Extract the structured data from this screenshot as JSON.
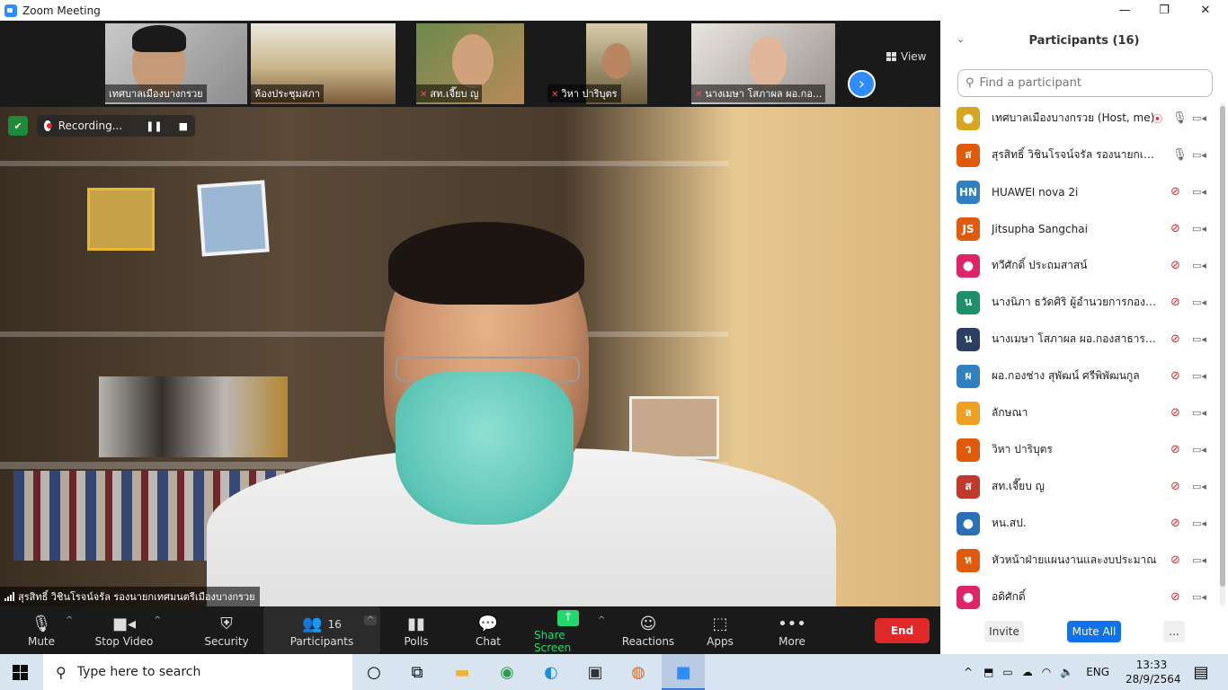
{
  "window": {
    "title": "Zoom Meeting",
    "controls": {
      "minimize": "—",
      "restore": "❐",
      "close": "✕"
    }
  },
  "thumbnails": [
    {
      "label": "เทศบาลเมืองบางกรวย",
      "muted": false
    },
    {
      "label": "ห้องประชุมสภา",
      "muted": false
    },
    {
      "label": "สท.เจี๊ยบ ญ",
      "muted": true
    },
    {
      "label": "วิหา ปาริบุตร",
      "muted": true
    },
    {
      "label": "นางเมษา โสภาผล ผอ.กอ...",
      "muted": true
    }
  ],
  "strip": {
    "next_glyph": "›",
    "view_label": "View"
  },
  "recording": {
    "label": "Recording...",
    "pause": "❚❚",
    "stop": "■",
    "shield": "✔"
  },
  "active_speaker": {
    "name": "สุรสิทธิ์ วิชินโรจน์จรัล รองนายกเทศมนตรีเมืองบางกรวย"
  },
  "toolbar": {
    "mute": "Mute",
    "stop_video": "Stop Video",
    "security": "Security",
    "participants": "Participants",
    "participants_count": "16",
    "polls": "Polls",
    "chat": "Chat",
    "share_screen": "Share Screen",
    "reactions": "Reactions",
    "apps": "Apps",
    "more": "More",
    "end": "End"
  },
  "panel": {
    "title": "Participants (16)",
    "search_placeholder": "Find a participant",
    "participants": [
      {
        "initials": "",
        "name": "เทศบาลเมืองบางกรวย (Host, me)",
        "color": "#d8a520",
        "mic": "on",
        "rec": true
      },
      {
        "initials": "ส",
        "name": "สุรสิทธิ์ วิชินโรจน์จรัล รองนายกเทศม...",
        "color": "#e05a0c",
        "mic": "on",
        "rec": false
      },
      {
        "initials": "HN",
        "name": "HUAWEI nova 2i",
        "color": "#2f7fc1",
        "mic": "off",
        "rec": false
      },
      {
        "initials": "JS",
        "name": "Jitsupha Sangchai",
        "color": "#e05a0c",
        "mic": "off",
        "rec": false
      },
      {
        "initials": "",
        "name": "ทวีศักดิ์ ประถมสาสน์",
        "color": "#e0246a",
        "mic": "off",
        "rec": false
      },
      {
        "initials": "น",
        "name": "นางนิภา ธวัดศิริ  ผู้อำนวยการกองคลัง",
        "color": "#1e8f6b",
        "mic": "off",
        "rec": false
      },
      {
        "initials": "น",
        "name": "นางเมษา โสภาผล ผอ.กองสาธารณสุ...",
        "color": "#2b3f63",
        "mic": "off",
        "rec": false
      },
      {
        "initials": "ผ",
        "name": "ผอ.กองช่าง สุพัฒน์ ศรีพิพัฒนกูล",
        "color": "#2f7fc1",
        "mic": "off",
        "rec": false
      },
      {
        "initials": "ล",
        "name": "ลักษณา",
        "color": "#f0a020",
        "mic": "off",
        "rec": false
      },
      {
        "initials": "ว",
        "name": "วิหา ปาริบุตร",
        "color": "#e05a0c",
        "mic": "off",
        "rec": false
      },
      {
        "initials": "ส",
        "name": "สท.เจี๊ยบ ญ",
        "color": "#c0392b",
        "mic": "off",
        "rec": false
      },
      {
        "initials": "",
        "name": "หน.สป.",
        "color": "#2a6fb7",
        "mic": "off",
        "rec": false
      },
      {
        "initials": "ห",
        "name": "หัวหน้าฝ่ายแผนงานและงบประมาณ",
        "color": "#e05a0c",
        "mic": "off",
        "rec": false
      },
      {
        "initials": "",
        "name": "อดิศักดิ์",
        "color": "#e0246a",
        "mic": "off",
        "rec": false
      }
    ],
    "invite": "Invite",
    "mute_all": "Mute All",
    "more": "..."
  },
  "taskbar": {
    "search_placeholder": "Type here to search",
    "language": "ENG",
    "time": "13:33",
    "date": "28/9/2564"
  }
}
